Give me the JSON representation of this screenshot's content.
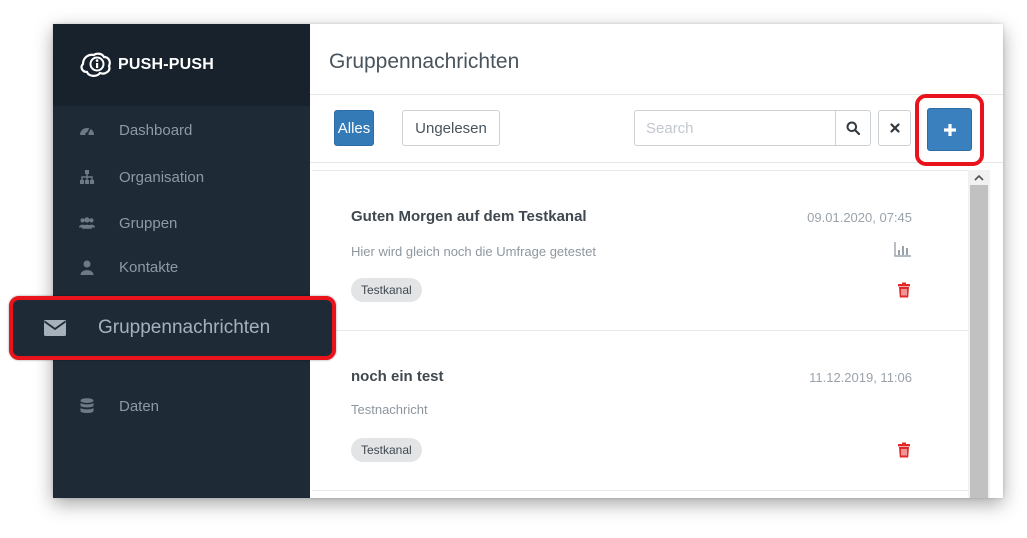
{
  "app": {
    "brand": "PUSH-PUSH"
  },
  "sidebar": {
    "items": [
      {
        "label": "Dashboard",
        "icon": "dashboard-icon"
      },
      {
        "label": "Organisation",
        "icon": "sitemap-icon"
      },
      {
        "label": "Gruppen",
        "icon": "users-icon"
      },
      {
        "label": "Kontakte",
        "icon": "user-icon"
      },
      {
        "label": "Gruppennachrichten",
        "icon": "envelope-icon",
        "active": true
      },
      {
        "label": "Daten",
        "icon": "database-icon"
      }
    ]
  },
  "main": {
    "title": "Gruppennachrichten",
    "filters": {
      "all": "Alles",
      "unread": "Ungelesen"
    },
    "search": {
      "placeholder": "Search",
      "value": ""
    },
    "icons": {
      "search": "search-icon",
      "clear": "close-icon",
      "add": "plus-icon"
    }
  },
  "messages": [
    {
      "title": "Guten Morgen auf dem Testkanal",
      "date": "09.01.2020, 07:45",
      "text": "Hier wird gleich noch die Umfrage getestet",
      "tag": "Testkanal",
      "has_poll": true
    },
    {
      "title": "noch ein test",
      "date": "11.12.2019, 11:06",
      "text": "Testnachricht",
      "tag": "Testkanal",
      "has_poll": false
    }
  ],
  "colors": {
    "sidebar_bg": "#1e2b37",
    "brand_bg": "#17222c",
    "primary": "#337ab7",
    "highlight": "#e8131b",
    "danger": "#e22a2a"
  }
}
